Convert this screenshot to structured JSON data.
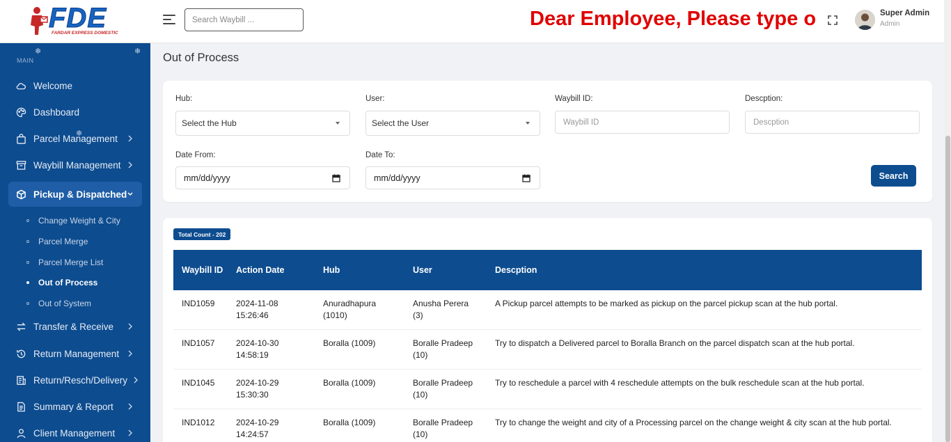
{
  "header": {
    "logo_text": "FDE",
    "logo_subtitle": "FARDAR EXPRESS DOMESTIC",
    "search_placeholder": "Search Waybill ...",
    "announcement": "Dear Employee, Please type o",
    "user_name": "Super Admin",
    "user_role": "Admin",
    "announcement_color": "#e00000"
  },
  "sidebar": {
    "section_label": "MAIN",
    "bg_color": "#0d4c8f",
    "items": [
      {
        "label": "Welcome",
        "icon": "cloud-icon"
      },
      {
        "label": "Dashboard",
        "icon": "palette-icon"
      },
      {
        "label": "Parcel Management",
        "icon": "bag-icon"
      },
      {
        "label": "Waybill Management",
        "icon": "archive-icon"
      },
      {
        "label": "Pickup & Dispatched",
        "icon": "box-icon"
      },
      {
        "label": "Transfer & Receive",
        "icon": "transfer-icon"
      },
      {
        "label": "Return Management",
        "icon": "history-icon"
      },
      {
        "label": "Return/Resch/Delivery",
        "icon": "document-icon"
      },
      {
        "label": "Summary & Report",
        "icon": "report-icon"
      },
      {
        "label": "Client Management",
        "icon": "user-icon"
      }
    ],
    "subitems": [
      {
        "label": "Change Weight & City"
      },
      {
        "label": "Parcel Merge"
      },
      {
        "label": "Parcel Merge List"
      },
      {
        "label": "Out of Process"
      },
      {
        "label": "Out of System"
      }
    ]
  },
  "page": {
    "title": "Out of Process"
  },
  "filters": {
    "hub_label": "Hub:",
    "hub_value": "Select the Hub",
    "user_label": "User:",
    "user_value": "Select the User",
    "waybill_label": "Waybill ID:",
    "waybill_placeholder": "Waybill ID",
    "desc_label": "Descption:",
    "desc_placeholder": "Descption",
    "date_from_label": "Date From:",
    "date_from_value": "mm/dd/yyyy",
    "date_to_label": "Date To:",
    "date_to_value": "mm/dd/yyyy",
    "search_button": "Search"
  },
  "table": {
    "count_badge": "Total Count - 202",
    "headers": [
      "Waybill ID",
      "Action Date",
      "Hub",
      "User",
      "Descption"
    ],
    "rows": [
      {
        "id": "IND1059",
        "date": "2024-11-08",
        "time": "15:26:46",
        "hub": "Anuradhapura",
        "hub_code": "(1010)",
        "user": "Anusha Perera",
        "user_code": "(3)",
        "desc": "A Pickup parcel attempts to be marked as pickup on the parcel pickup scan at the hub portal."
      },
      {
        "id": "IND1057",
        "date": "2024-10-30",
        "time": "14:58:19",
        "hub": "Boralla (1009)",
        "hub_code": "",
        "user": "Boralle Pradeep",
        "user_code": "(10)",
        "desc": "Try to dispatch a Delivered parcel to Boralla Branch on the parcel dispatch scan at the hub portal."
      },
      {
        "id": "IND1045",
        "date": "2024-10-29",
        "time": "15:30:30",
        "hub": "Boralla (1009)",
        "hub_code": "",
        "user": "Boralle Pradeep",
        "user_code": "(10)",
        "desc": "Try to reschedule a parcel with 4 reschedule attempts on the bulk reschedule scan at the hub portal."
      },
      {
        "id": "IND1012",
        "date": "2024-10-29",
        "time": "14:24:57",
        "hub": "Boralla (1009)",
        "hub_code": "",
        "user": "Boralle Pradeep",
        "user_code": "(10)",
        "desc": "Try to change the weight and city of a Processing parcel on the change weight & city scan at the hub portal."
      }
    ]
  }
}
